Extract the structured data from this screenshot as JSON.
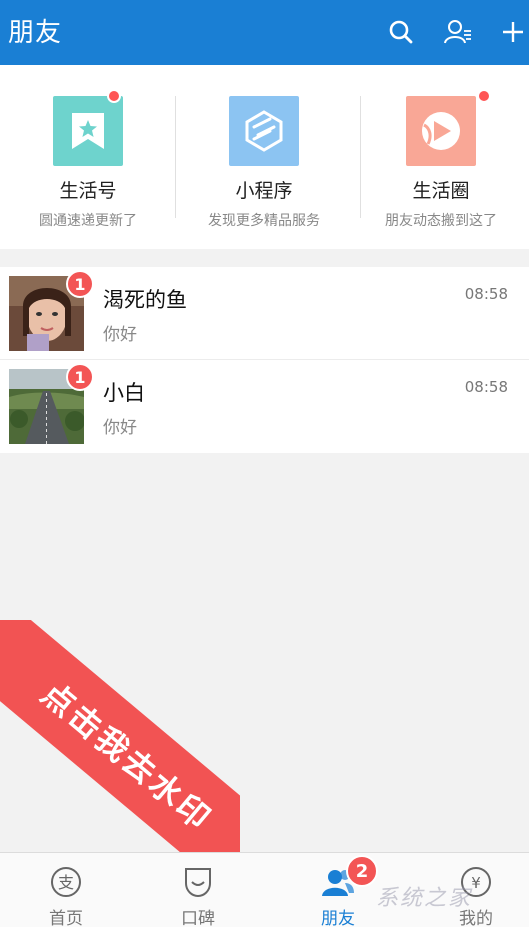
{
  "header": {
    "title": "朋友"
  },
  "services": [
    {
      "name": "生活号",
      "desc": "圆通速递更新了",
      "color": "#6ed3cd",
      "icon": "bookmark-star-icon",
      "dot": true
    },
    {
      "name": "小程序",
      "desc": "发现更多精品服务",
      "color": "#8cc4f2",
      "icon": "mini-program-icon",
      "dot": false
    },
    {
      "name": "生活圈",
      "desc": "朋友动态搬到这了",
      "color": "#f9a796",
      "icon": "life-circle-icon",
      "dot": true
    }
  ],
  "chats": [
    {
      "name": "渴死的鱼",
      "message": "你好",
      "time": "08:58",
      "unread": "1",
      "avatar": "portrait-avatar"
    },
    {
      "name": "小白",
      "message": "你好",
      "time": "08:58",
      "unread": "1",
      "avatar": "road-landscape-avatar"
    }
  ],
  "ribbon": {
    "text": "点击我去水印"
  },
  "tabs": [
    {
      "label": "首页",
      "icon": "alipay-home-icon",
      "active": false
    },
    {
      "label": "口碑",
      "icon": "koubei-icon",
      "active": false
    },
    {
      "label": "朋友",
      "icon": "friends-icon",
      "active": true,
      "badge": "2"
    },
    {
      "label": "我的",
      "icon": "my-account-icon",
      "active": false
    }
  ],
  "watermark": {
    "text": "系统之家"
  },
  "colors": {
    "primary": "#1a7fd4",
    "badge": "#f35555",
    "ribbon": "#f25353"
  }
}
